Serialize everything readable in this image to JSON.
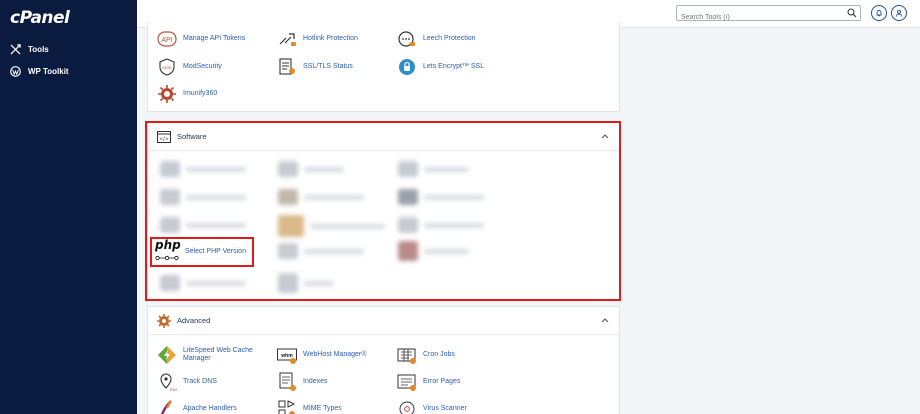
{
  "app": {
    "logo_text": "cPanel"
  },
  "sidebar": {
    "items": [
      {
        "label": "Tools",
        "icon": "tools-icon"
      },
      {
        "label": "WP Toolkit",
        "icon": "wordpress-icon"
      }
    ]
  },
  "topbar": {
    "search_placeholder": "Search Tools (/)",
    "buttons": [
      {
        "icon": "bell-icon"
      },
      {
        "icon": "user-icon"
      }
    ]
  },
  "security": {
    "items": [
      {
        "label": "Manage API Tokens",
        "icon": "api-icon"
      },
      {
        "label": "Hotlink Protection",
        "icon": "hotlink-icon"
      },
      {
        "label": "Leech Protection",
        "icon": "leech-icon"
      },
      {
        "label": "ModSecurity",
        "icon": "modsecurity-icon"
      },
      {
        "label": "SSL/TLS Status",
        "icon": "ssl-status-icon"
      },
      {
        "label": "Lets Encrypt™ SSL",
        "icon": "lets-encrypt-icon"
      },
      {
        "label": "Imunify360",
        "icon": "imunify-icon"
      }
    ]
  },
  "software": {
    "title": "Software",
    "select_php_label": "Select PHP Version",
    "php_logo_text": "php"
  },
  "advanced": {
    "title": "Advanced",
    "items": [
      {
        "label_line1": "LiteSpeed Web Cache",
        "label_line2": "Manager",
        "icon": "litespeed-icon"
      },
      {
        "label": "WebHost Manager®",
        "icon": "whm-icon"
      },
      {
        "label": "Cron Jobs",
        "icon": "cron-icon"
      },
      {
        "label": "Track DNS",
        "icon": "track-dns-icon"
      },
      {
        "label": "Indexes",
        "icon": "indexes-icon"
      },
      {
        "label": "Error Pages",
        "icon": "error-pages-icon"
      },
      {
        "label": "Apache Handlers",
        "icon": "apache-handlers-icon"
      },
      {
        "label": "MIME Types",
        "icon": "mime-types-icon"
      },
      {
        "label": "Virus Scanner",
        "icon": "virus-scanner-icon"
      }
    ]
  },
  "colors": {
    "sidebar_bg": "#0b1b3f",
    "link": "#2b5fae",
    "highlight": "#e01a1a",
    "page_bg": "#f3f6f8"
  }
}
